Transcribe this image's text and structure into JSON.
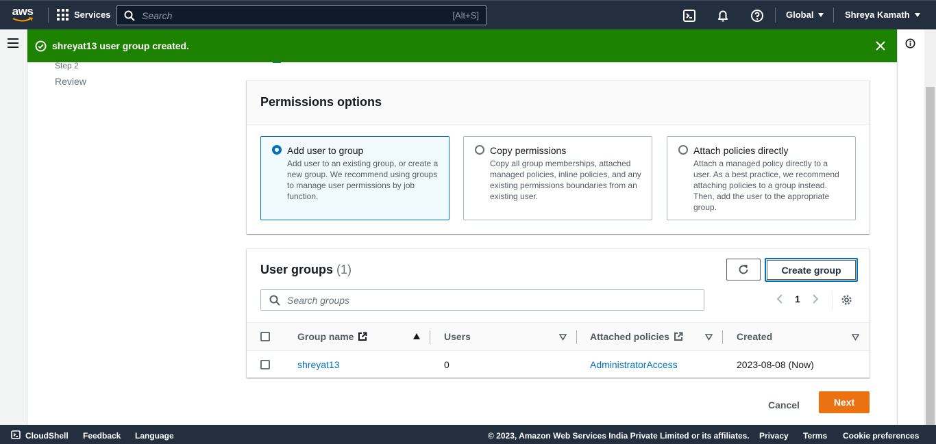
{
  "topnav": {
    "logo_text": "aws",
    "services_label": "Services",
    "search_placeholder": "Search",
    "search_shortcut": "[Alt+S]",
    "region_label": "Global",
    "user_label": "Shreya Kamath"
  },
  "flash": {
    "message": "shreyat13 user group created.",
    "status_color": "#1d8102"
  },
  "steps": {
    "step_label": "Step 2",
    "step_title": "Review"
  },
  "permissions": {
    "title": "Permissions options",
    "options": [
      {
        "title": "Add user to group",
        "description": "Add user to an existing group, or create a new group. We recommend using groups to manage user permissions by job function.",
        "selected": true
      },
      {
        "title": "Copy permissions",
        "description": "Copy all group memberships, attached managed policies, inline policies, and any existing permissions boundaries from an existing user.",
        "selected": false
      },
      {
        "title": "Attach policies directly",
        "description": "Attach a managed policy directly to a user. As a best practice, we recommend attaching policies to a group instead. Then, add the user to the appropriate group.",
        "selected": false
      }
    ]
  },
  "user_groups": {
    "title": "User groups",
    "count": "(1)",
    "create_button": "Create group",
    "search_placeholder": "Search groups",
    "current_page": "1",
    "columns": [
      "Group name",
      "Users",
      "Attached policies",
      "Created"
    ],
    "rows": [
      {
        "group_name": "shreyat13",
        "users": "0",
        "attached_policies": "AdministratorAccess",
        "created": "2023-08-08 (Now)"
      }
    ]
  },
  "actions": {
    "cancel": "Cancel",
    "next": "Next",
    "primary_color": "#ec7211"
  },
  "footer": {
    "cloudshell": "CloudShell",
    "feedback": "Feedback",
    "language": "Language",
    "copyright": "© 2023, Amazon Web Services India Private Limited or its affiliates.",
    "privacy": "Privacy",
    "terms": "Terms",
    "cookie": "Cookie preferences"
  }
}
